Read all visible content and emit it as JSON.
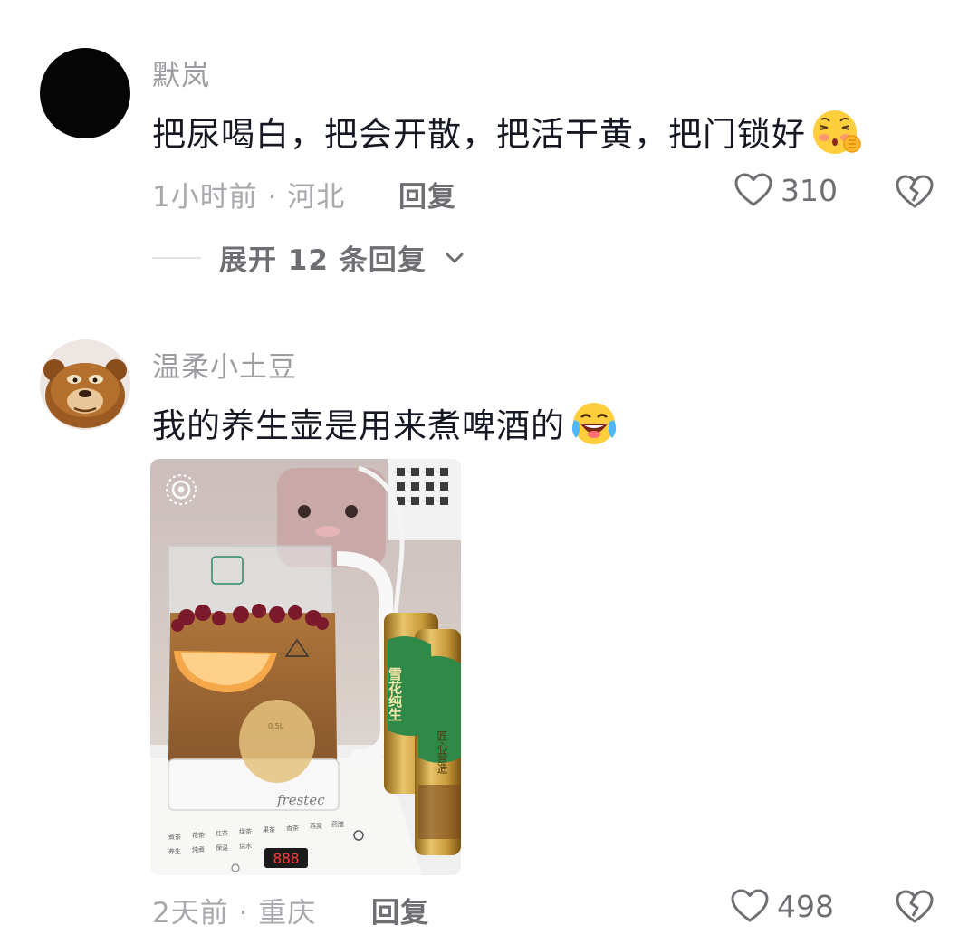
{
  "comments": [
    {
      "username": "默岚",
      "text": "把尿喝白，把会开散，把活干黄，把门锁好",
      "emoji_icon": "zipper-mouth-blushing-emoji-icon",
      "time_location": "1小时前 · 河北",
      "reply_label": "回复",
      "likes": "310",
      "expand_label": "展开 12 条回复"
    },
    {
      "username": "温柔小土豆",
      "text": "我的养生壶是用来煮啤酒的",
      "emoji_icon": "crying-laughing-emoji-icon",
      "photo": {
        "kettle_brand": "frestec",
        "kettle_display": "888",
        "can_label_1": "雪花纯生",
        "can_label_2": "匠心营造"
      },
      "time_location": "2天前 · 重庆",
      "reply_label": "回复",
      "likes": "498"
    }
  ],
  "colors": {
    "text_primary": "#161823",
    "text_secondary": "#a8a8ad",
    "text_action": "#6e6e73",
    "icon_gray": "#6e6e73"
  }
}
